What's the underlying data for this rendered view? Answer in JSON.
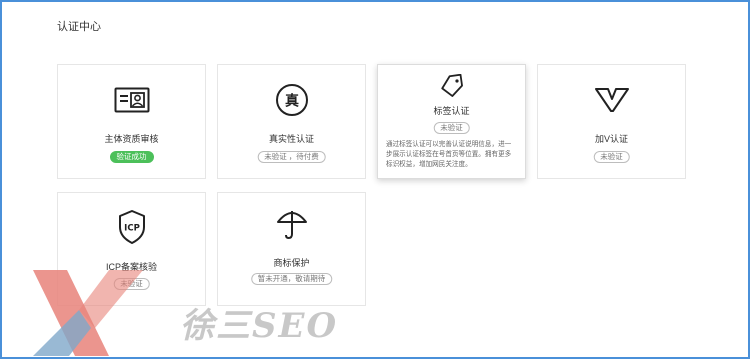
{
  "page": {
    "title": "认证中心"
  },
  "cards": [
    {
      "label": "主体资质审核",
      "badge": "验证成功",
      "icon": "id-card-icon"
    },
    {
      "label": "真实性认证",
      "badge": "未验证 ，待付费",
      "icon": "authentic-seal-icon",
      "icon_text": "真"
    },
    {
      "label": "标签认证",
      "badge": "未验证",
      "icon": "tag-icon",
      "description": "通过标签认证可以完善认证说明信息，进一步展示认证标签在号首页等位置。拥有更多标识权益，增加网民关注度。"
    },
    {
      "label": "加V认证",
      "badge": "未验证",
      "icon": "v-badge-icon"
    },
    {
      "label": "ICP备案核验",
      "badge": "未验证",
      "icon": "icp-shield-icon",
      "icon_text": "ICP"
    },
    {
      "label": "商标保护",
      "badge": "暂未开通，敬请期待",
      "icon": "umbrella-icon"
    }
  ],
  "watermark": {
    "text": "徐三SEO",
    "icon": "x-logo-watermark"
  },
  "colors": {
    "success": "#4cc05a",
    "frame": "#4a90d9",
    "border": "#e6e6e6",
    "watermark_red": "#e8837a",
    "watermark_blue": "#7fa7c9"
  }
}
